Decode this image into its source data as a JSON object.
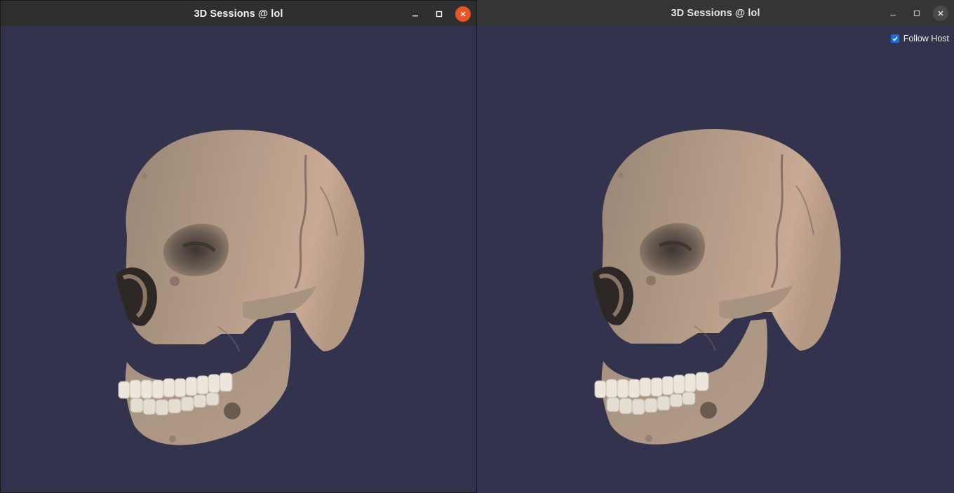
{
  "windows": [
    {
      "title": "3D Sessions @ lol",
      "active": true
    },
    {
      "title": "3D Sessions @ lol",
      "active": false
    }
  ],
  "follow_host": {
    "label": "Follow Host",
    "checked": true
  },
  "colors": {
    "viewport_bg": "#33334d",
    "close_accent": "#e95420",
    "checkbox_accent": "#1b6fd8",
    "bone": "#b7a08a",
    "teeth": "#ece6dd"
  },
  "icons": [
    "minimize-icon",
    "maximize-icon",
    "close-icon",
    "checkmark-icon"
  ]
}
